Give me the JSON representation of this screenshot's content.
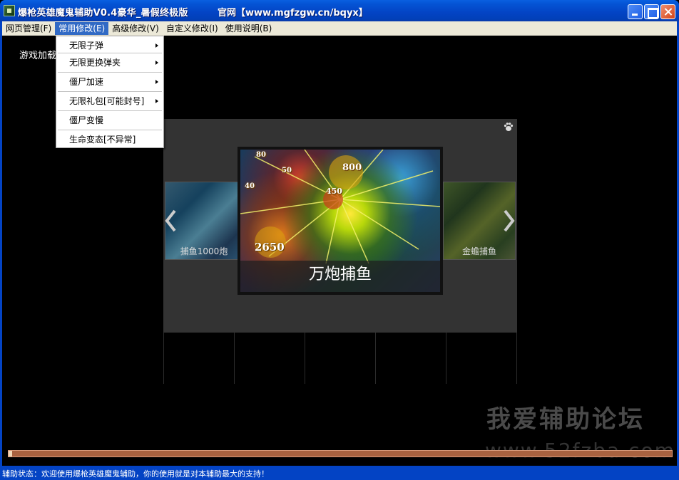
{
  "window": {
    "title": "爆枪英雄魔鬼辅助V0.4豪华_暑假终极版",
    "site": "官网【www.mgfzgw.cn/bqyx】"
  },
  "menubar": {
    "items": [
      {
        "label": "网页管理(F)"
      },
      {
        "label": "常用修改(E)"
      },
      {
        "label": "高级修改(V)"
      },
      {
        "label": "自定义修改(I)"
      },
      {
        "label": "使用说明(B)"
      }
    ],
    "active_index": 1
  },
  "dropdown": {
    "items": [
      {
        "label": "无限子弹",
        "submenu": true
      },
      {
        "label": "无限更换弹夹",
        "submenu": true
      },
      {
        "label": "僵尸加速",
        "submenu": true
      },
      {
        "label": "无限礼包[可能封号]",
        "submenu": true
      },
      {
        "label": "僵尸变慢",
        "submenu": false
      },
      {
        "label": "生命变态[不异常]",
        "submenu": false
      }
    ]
  },
  "content": {
    "loading_text": "游戏加载"
  },
  "carousel": {
    "left_card_label": "捕鱼1000炮",
    "main_card_label": "万炮捕鱼",
    "right_card_label": "金蟾捕鱼",
    "scores": [
      "800",
      "450",
      "2650",
      "80",
      "50",
      "40"
    ]
  },
  "watermark": {
    "cn": "我爱辅助论坛",
    "url": "www.52fzba.com"
  },
  "progress": {
    "percent": 100,
    "color": "#a86240"
  },
  "statusbar": {
    "text": "辅助状态：欢迎使用爆枪英雄魔鬼辅助，你的使用就是对本辅助最大的支持！"
  },
  "colors": {
    "titlebar": "#0343c4",
    "menu_active": "#316ac5",
    "menubar": "#ece9d8"
  },
  "icons": [
    "app-icon",
    "minimize-icon",
    "maximize-icon",
    "close-icon",
    "submenu-arrow-icon",
    "paw-icon",
    "chevron-left-icon",
    "chevron-right-icon"
  ]
}
